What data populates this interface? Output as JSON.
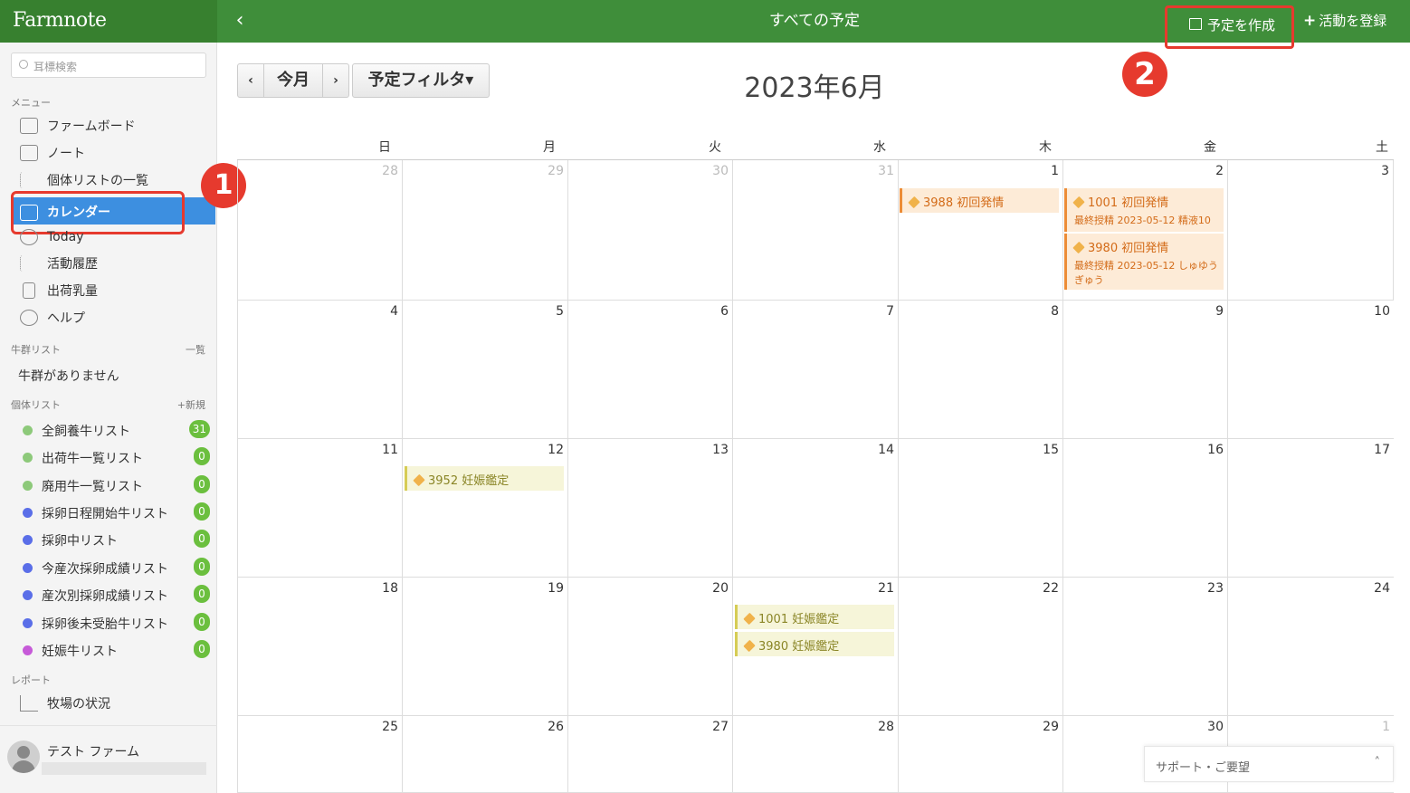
{
  "app": {
    "logo": "Farmnote",
    "page_title": "すべての予定",
    "back": "‹"
  },
  "topbar": {
    "create_label": "予定を作成",
    "register_plus": "+",
    "register_label": "活動を登録"
  },
  "annotations": {
    "badge1": "1",
    "badge2": "2"
  },
  "sidebar": {
    "search_placeholder": "耳標検索",
    "menu_title": "メニュー",
    "menu": [
      {
        "label": "ファームボード",
        "icon": "farm-board-icon"
      },
      {
        "label": "ノート",
        "icon": "note-icon"
      },
      {
        "label": "個体リストの一覧",
        "icon": "list-icon"
      },
      {
        "label": "カレンダー",
        "icon": "calendar-icon",
        "active": true
      },
      {
        "label": "Today",
        "icon": "today-icon"
      },
      {
        "label": "活動履歴",
        "icon": "activity-history-icon"
      },
      {
        "label": "出荷乳量",
        "icon": "milk-bottle-icon"
      },
      {
        "label": "ヘルプ",
        "icon": "help-icon"
      }
    ],
    "herd_title": "牛群リスト",
    "herd_link": "一覧",
    "herd_empty": "牛群がありません",
    "individual_title": "個体リスト",
    "individual_link": "+新規",
    "lists": [
      {
        "label": "全飼養牛リスト",
        "count": "31",
        "color": "#8dc97a"
      },
      {
        "label": "出荷牛一覧リスト",
        "count": "0",
        "color": "#8dc97a"
      },
      {
        "label": "廃用牛一覧リスト",
        "count": "0",
        "color": "#8dc97a"
      },
      {
        "label": "採卵日程開始牛リスト",
        "count": "0",
        "color": "#5a6ee8"
      },
      {
        "label": "採卵中リスト",
        "count": "0",
        "color": "#5a6ee8"
      },
      {
        "label": "今産次採卵成績リスト",
        "count": "0",
        "color": "#5a6ee8"
      },
      {
        "label": "産次別採卵成績リスト",
        "count": "0",
        "color": "#5a6ee8"
      },
      {
        "label": "採卵後未受胎牛リスト",
        "count": "0",
        "color": "#5a6ee8"
      },
      {
        "label": "妊娠牛リスト",
        "count": "0",
        "color": "#c65ad8"
      }
    ],
    "report_title": "レポート",
    "report_item": "牧場の状況",
    "user_name": "テスト ファーム"
  },
  "calendar": {
    "prev": "‹",
    "today": "今月",
    "next": "›",
    "filter": "予定フィルタ▾",
    "month_title": "2023年6月",
    "weekdays": [
      "日",
      "月",
      "火",
      "水",
      "木",
      "金",
      "土"
    ],
    "weeks": [
      [
        "28",
        "29",
        "30",
        "31",
        "1",
        "2",
        "3"
      ],
      [
        "4",
        "5",
        "6",
        "7",
        "8",
        "9",
        "10"
      ],
      [
        "11",
        "12",
        "13",
        "14",
        "15",
        "16",
        "17"
      ],
      [
        "18",
        "19",
        "20",
        "21",
        "22",
        "23",
        "24"
      ],
      [
        "25",
        "26",
        "27",
        "28",
        "29",
        "30",
        "1"
      ]
    ],
    "events": {
      "e1": {
        "title": "3988 初回発情"
      },
      "e2": {
        "title": "1001 初回発情",
        "sub": "最終授精 2023-05-12 精液10"
      },
      "e3": {
        "title": "3980 初回発情",
        "sub": "最終授精 2023-05-12 しゅゆうぎゅう"
      },
      "e4": {
        "title": "3952 妊娠鑑定"
      },
      "e5": {
        "title": "1001 妊娠鑑定"
      },
      "e6": {
        "title": "3980 妊娠鑑定"
      }
    }
  },
  "support": {
    "label": "サポート・ご要望",
    "caret": "˄"
  },
  "colors": {
    "brand_green": "#3f8e3a",
    "active_blue": "#3d8fe0",
    "highlight_red": "#e63a2e"
  }
}
